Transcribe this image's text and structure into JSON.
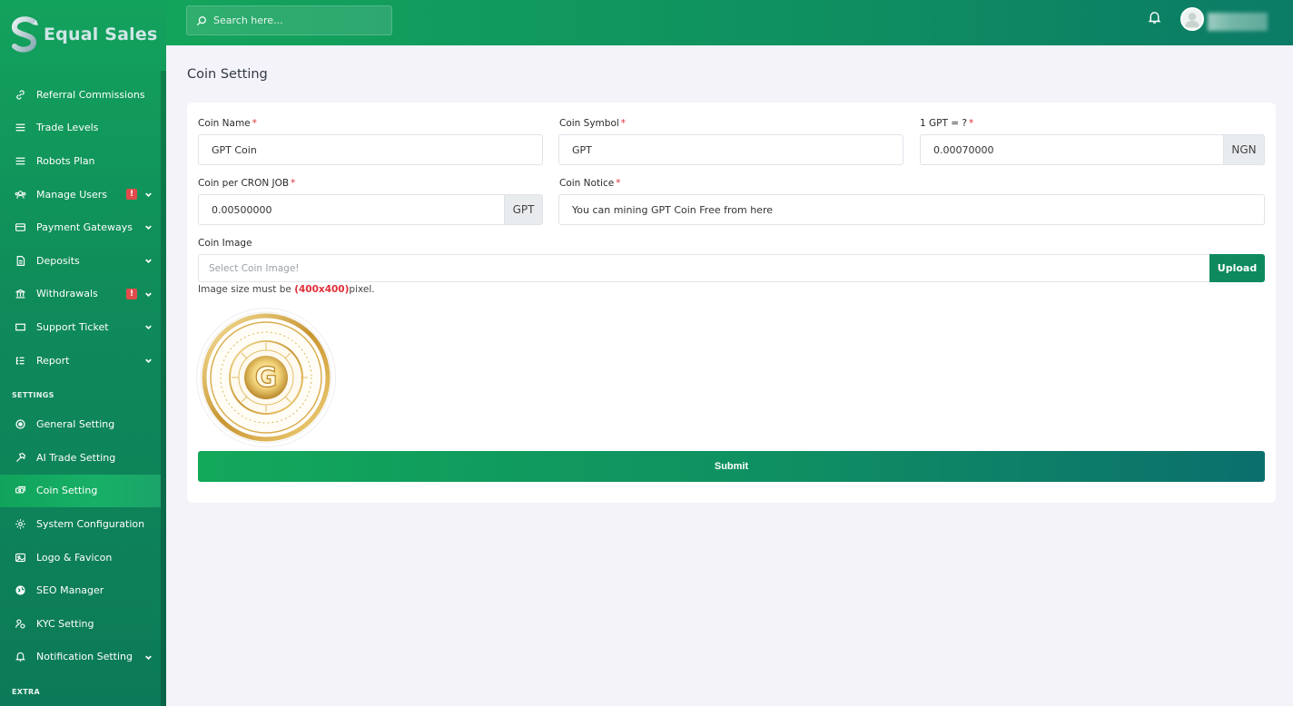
{
  "brand": {
    "name": "Equal Sales"
  },
  "topbar": {
    "search_placeholder": "Search here..."
  },
  "sidebar": {
    "items": [
      {
        "label": "Referral Commissions",
        "icon": "link-icon"
      },
      {
        "label": "Trade Levels",
        "icon": "menu-lines-icon"
      },
      {
        "label": "Robots Plan",
        "icon": "menu-lines-icon"
      },
      {
        "label": "Manage Users",
        "icon": "users-icon",
        "badge": "!",
        "expandable": true
      },
      {
        "label": "Payment Gateways",
        "icon": "card-icon",
        "expandable": true
      },
      {
        "label": "Deposits",
        "icon": "deposit-icon",
        "expandable": true
      },
      {
        "label": "Withdrawals",
        "icon": "bank-icon",
        "badge": "!",
        "expandable": true
      },
      {
        "label": "Support Ticket",
        "icon": "ticket-icon",
        "expandable": true
      },
      {
        "label": "Report",
        "icon": "list-icon",
        "expandable": true
      }
    ],
    "settings_section": "SETTINGS",
    "settings_items": [
      {
        "label": "General Setting",
        "icon": "gear-icon"
      },
      {
        "label": "AI Trade Setting",
        "icon": "hammer-icon"
      },
      {
        "label": "Coin Setting",
        "icon": "coins-icon",
        "active": true
      },
      {
        "label": "System Configuration",
        "icon": "cog-icon"
      },
      {
        "label": "Logo & Favicon",
        "icon": "image-icon"
      },
      {
        "label": "SEO Manager",
        "icon": "globe-icon"
      },
      {
        "label": "KYC Setting",
        "icon": "user-check-icon"
      },
      {
        "label": "Notification Setting",
        "icon": "bell-icon",
        "expandable": true
      }
    ],
    "extra_section": "EXTRA"
  },
  "page": {
    "title": "Coin Setting"
  },
  "form": {
    "coin_name": {
      "label": "Coin Name",
      "value": "GPT Coin"
    },
    "coin_symbol": {
      "label": "Coin Symbol",
      "value": "GPT"
    },
    "rate": {
      "label": "1 GPT = ?",
      "value": "0.00070000",
      "addon": "NGN"
    },
    "coin_per_cron": {
      "label": "Coin per CRON JOB",
      "value": "0.00500000",
      "addon": "GPT"
    },
    "coin_notice": {
      "label": "Coin Notice",
      "value": "You can mining GPT Coin Free from here"
    },
    "coin_image": {
      "label": "Coin Image",
      "placeholder": "Select Coin Image!",
      "upload_label": "Upload"
    },
    "hint_prefix": "Image size must be ",
    "hint_size": "(400x400)",
    "hint_suffix": "pixel.",
    "submit_label": "Submit"
  },
  "colors": {
    "accent": "#0e8a5e",
    "required": "#e0303a"
  }
}
